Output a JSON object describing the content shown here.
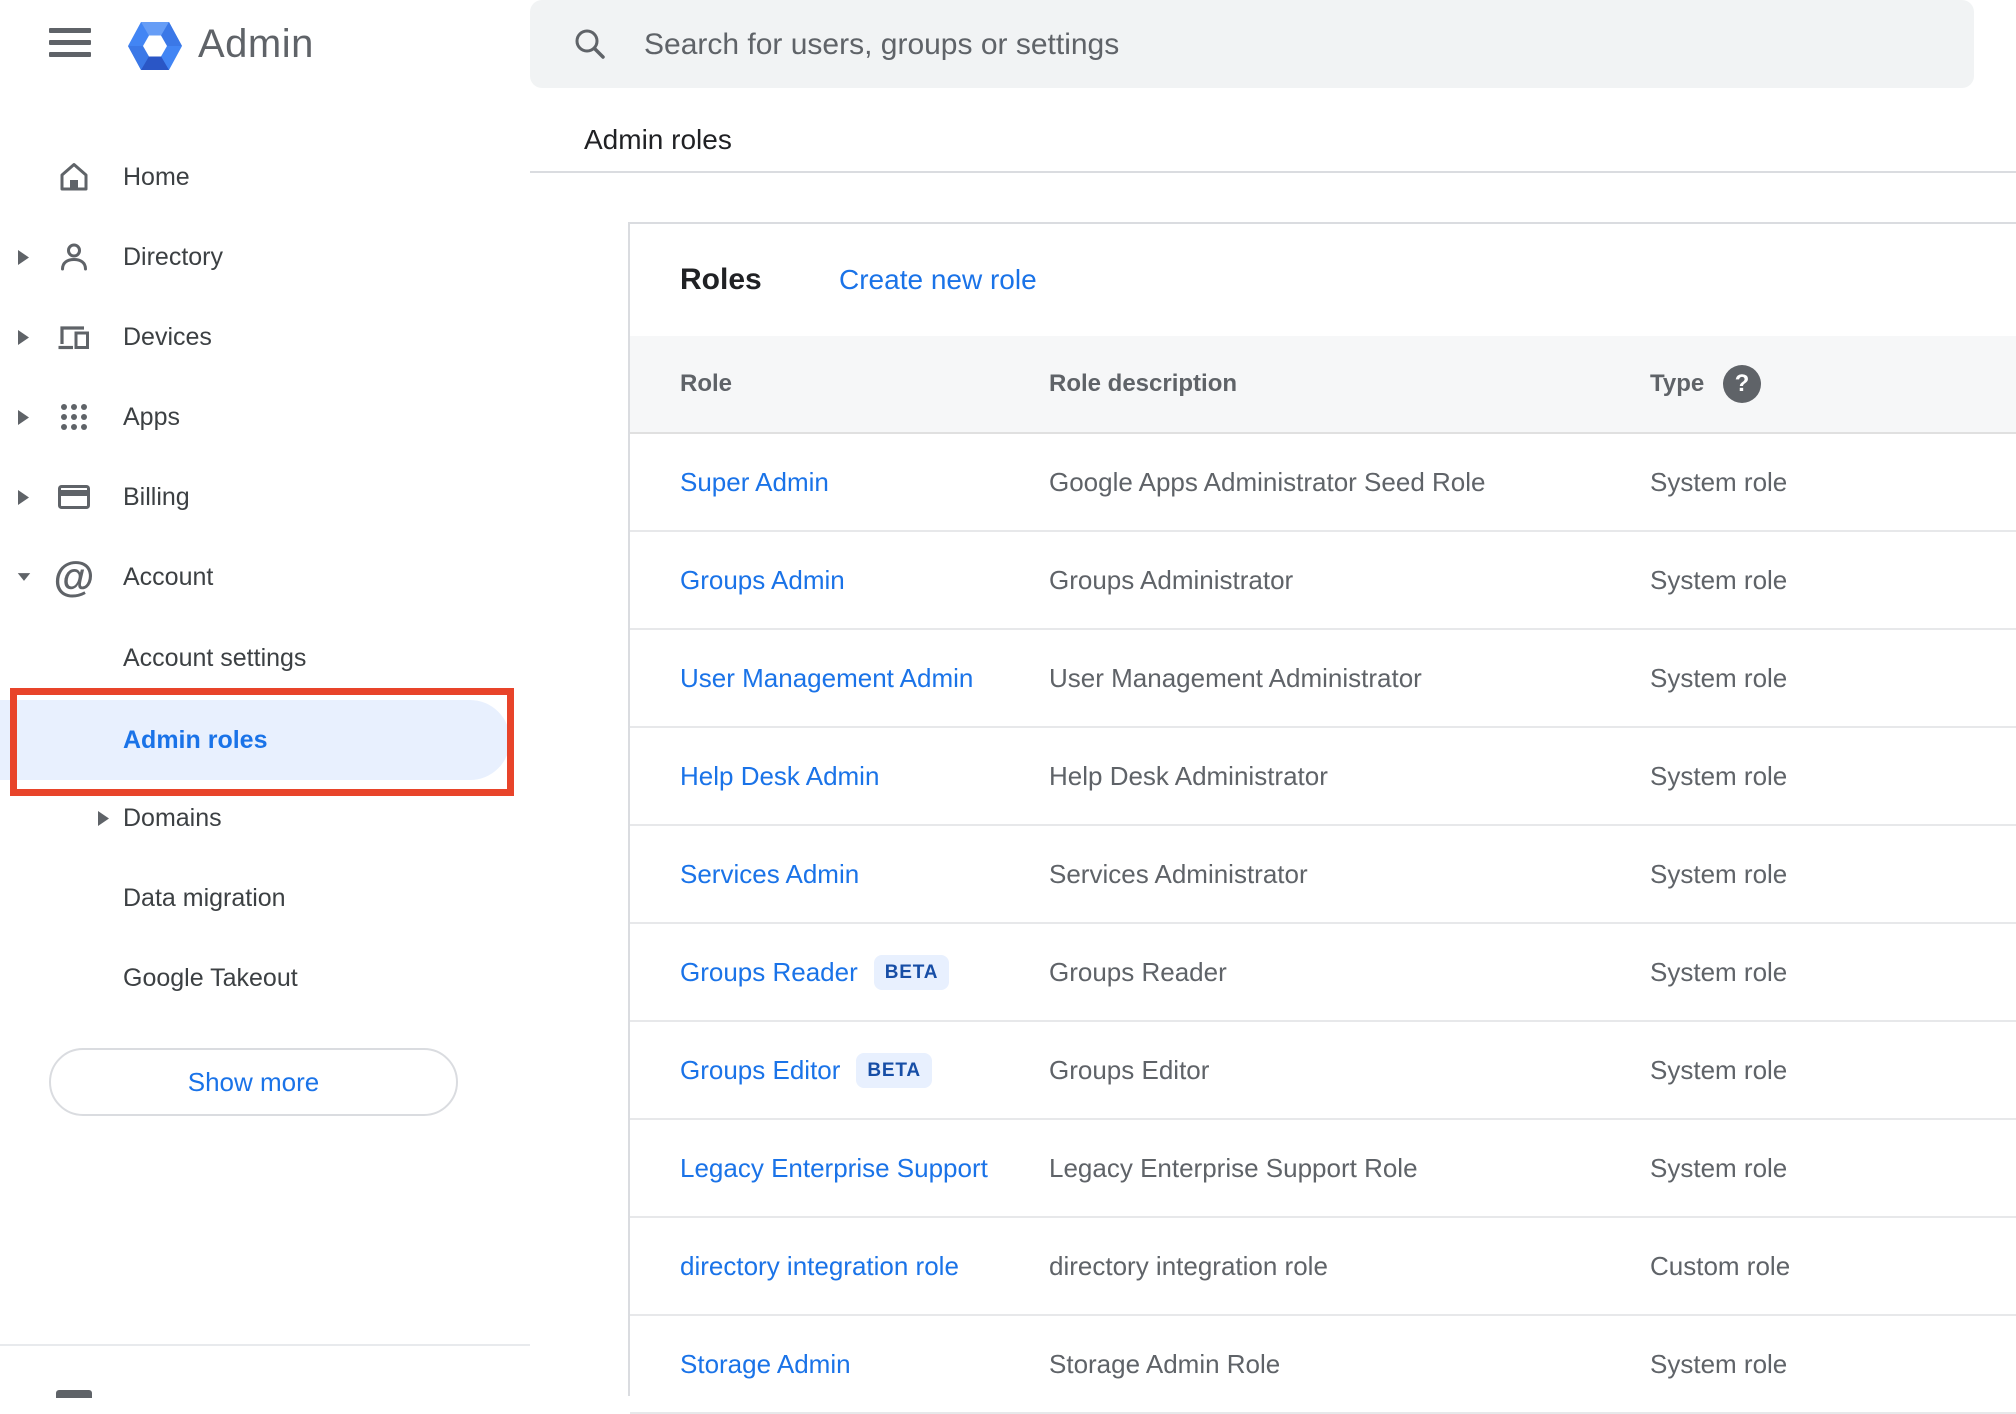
{
  "sidebar": {
    "logo": {
      "text": "Admin"
    },
    "nav": [
      {
        "label": "Home"
      },
      {
        "label": "Directory"
      },
      {
        "label": "Devices"
      },
      {
        "label": "Apps"
      },
      {
        "label": "Billing"
      },
      {
        "label": "Account"
      }
    ],
    "sub": [
      {
        "label": "Account settings"
      },
      {
        "label": "Admin roles",
        "selected": true
      },
      {
        "label": "Domains"
      },
      {
        "label": "Data migration"
      },
      {
        "label": "Google Takeout"
      }
    ],
    "show_more": "Show more"
  },
  "header": {
    "search_placeholder": "Search for users, groups or settings"
  },
  "breadcrumb": {
    "label": "Admin roles"
  },
  "card": {
    "title": "Roles",
    "create_label": "Create new role",
    "columns": [
      "Role",
      "Role description",
      "Type"
    ],
    "help_icon_glyph": "?",
    "beta_label": "BETA",
    "rows": [
      {
        "role": "Super Admin",
        "description": "Google Apps Administrator Seed Role",
        "type": "System role",
        "beta": false
      },
      {
        "role": "Groups Admin",
        "description": "Groups Administrator",
        "type": "System role",
        "beta": false
      },
      {
        "role": "User Management Admin",
        "description": "User Management Administrator",
        "type": "System role",
        "beta": false
      },
      {
        "role": "Help Desk Admin",
        "description": "Help Desk Administrator",
        "type": "System role",
        "beta": false
      },
      {
        "role": "Services Admin",
        "description": "Services Administrator",
        "type": "System role",
        "beta": false
      },
      {
        "role": "Groups Reader",
        "description": "Groups Reader",
        "type": "System role",
        "beta": true
      },
      {
        "role": "Groups Editor",
        "description": "Groups Editor",
        "type": "System role",
        "beta": true
      },
      {
        "role": "Legacy Enterprise Support",
        "description": "Legacy Enterprise Support Role",
        "type": "System role",
        "beta": false
      },
      {
        "role": "directory integration role",
        "description": "directory integration role",
        "type": "Custom role",
        "beta": false
      },
      {
        "role": "Storage Admin",
        "description": "Storage Admin Role",
        "type": "System role",
        "beta": false
      }
    ]
  },
  "colors": {
    "link_blue": "#1a73e8",
    "selected_item_bg": "#e8f0fe",
    "beta_text": "#174ea6",
    "annotation_red": "#e8442a",
    "text_primary": "#202124",
    "text_secondary": "#5f6368",
    "searchbar_bg": "#f1f3f4",
    "logo_blue": "#4285f4"
  }
}
